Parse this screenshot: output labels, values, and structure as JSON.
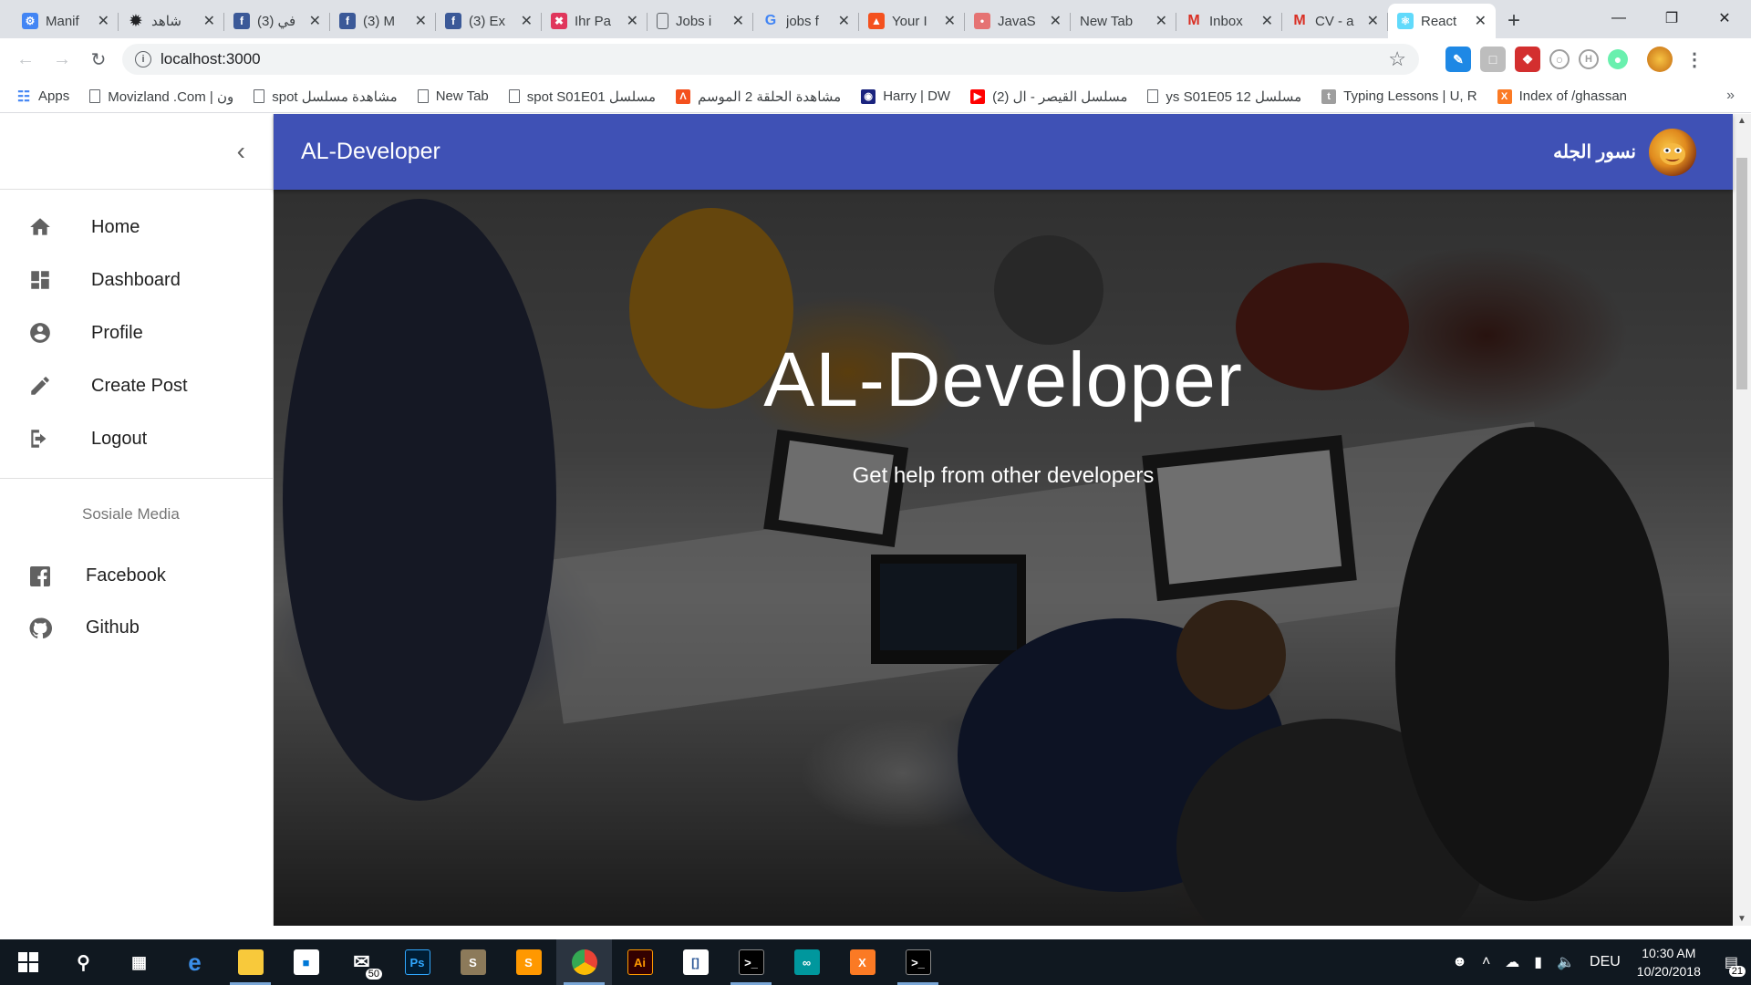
{
  "browser": {
    "tabs": [
      {
        "title": "Manif",
        "icon": "settings-icon",
        "color": "#4285f4"
      },
      {
        "title": "شاهد",
        "icon": "bug-icon",
        "color": "#202124"
      },
      {
        "title": "(3) في",
        "icon": "facebook-icon",
        "color": "#3b5998"
      },
      {
        "title": "(3) M",
        "icon": "facebook-icon",
        "color": "#3b5998"
      },
      {
        "title": "(3) Ex",
        "icon": "facebook-icon",
        "color": "#3b5998"
      },
      {
        "title": "Ihr Pa",
        "icon": "xing-icon",
        "color": "#e0365c"
      },
      {
        "title": "Jobs i",
        "icon": "page-icon",
        "color": "#5f6368"
      },
      {
        "title": "jobs f",
        "icon": "google-icon",
        "color": "#4285f4"
      },
      {
        "title": "Your I",
        "icon": "warning-icon",
        "color": "#f4511e"
      },
      {
        "title": "JavaS",
        "icon": "js-icon",
        "color": "#e57373"
      },
      {
        "title": "New Tab",
        "icon": "",
        "color": ""
      },
      {
        "title": "Inbox",
        "icon": "gmail-icon",
        "color": "#d93025"
      },
      {
        "title": "CV - a",
        "icon": "gmail-icon",
        "color": "#d93025"
      },
      {
        "title": "React",
        "icon": "react-icon",
        "color": "#61dafb",
        "active": true
      }
    ],
    "new_tab_label": "+",
    "address": "localhost:3000",
    "bookmarks": [
      {
        "label": "Apps",
        "icon": "apps-icon"
      },
      {
        "label": "Movizland .Com | ون",
        "icon": "page-icon"
      },
      {
        "label": "spot مشاهدة مسلسل",
        "icon": "page-icon"
      },
      {
        "label": "New Tab",
        "icon": "page-icon"
      },
      {
        "label": "spot S01E01 مسلسل",
        "icon": "page-icon"
      },
      {
        "label": "مشاهدة الحلقة 2 الموسم",
        "icon": "warning-icon"
      },
      {
        "label": "Harry | DW",
        "icon": "dw-icon"
      },
      {
        "label": "(2) مسلسل القيصر - ال",
        "icon": "youtube-icon"
      },
      {
        "label": "ys S01E05 12 مسلسل",
        "icon": "page-icon"
      },
      {
        "label": "Typing Lessons | U, R",
        "icon": "typing-icon"
      },
      {
        "label": "Index of /ghassan",
        "icon": "xampp-icon"
      }
    ],
    "bookmarks_more": "»"
  },
  "app": {
    "brand": "AL-Developer",
    "user_name": "نسور الجله",
    "menu": [
      {
        "label": "Home",
        "icon": "home-icon"
      },
      {
        "label": "Dashboard",
        "icon": "dashboard-icon"
      },
      {
        "label": "Profile",
        "icon": "account-circle-icon"
      },
      {
        "label": "Create Post",
        "icon": "pencil-icon"
      },
      {
        "label": "Logout",
        "icon": "logout-icon"
      }
    ],
    "social_header": "Sosiale Media",
    "social": [
      {
        "label": "Facebook",
        "icon": "facebook-icon"
      },
      {
        "label": "Github",
        "icon": "github-icon"
      }
    ],
    "hero": {
      "title": "AL-Developer",
      "subtitle": "Get help from other developers"
    }
  },
  "taskbar": {
    "mail_badge": "50",
    "language": "DEU",
    "time": "10:30 AM",
    "date": "10/20/2018",
    "notifications": "21"
  },
  "colors": {
    "appbar": "#3f51b5",
    "tabstrip": "#dee1e6",
    "taskbar": "#101820"
  }
}
